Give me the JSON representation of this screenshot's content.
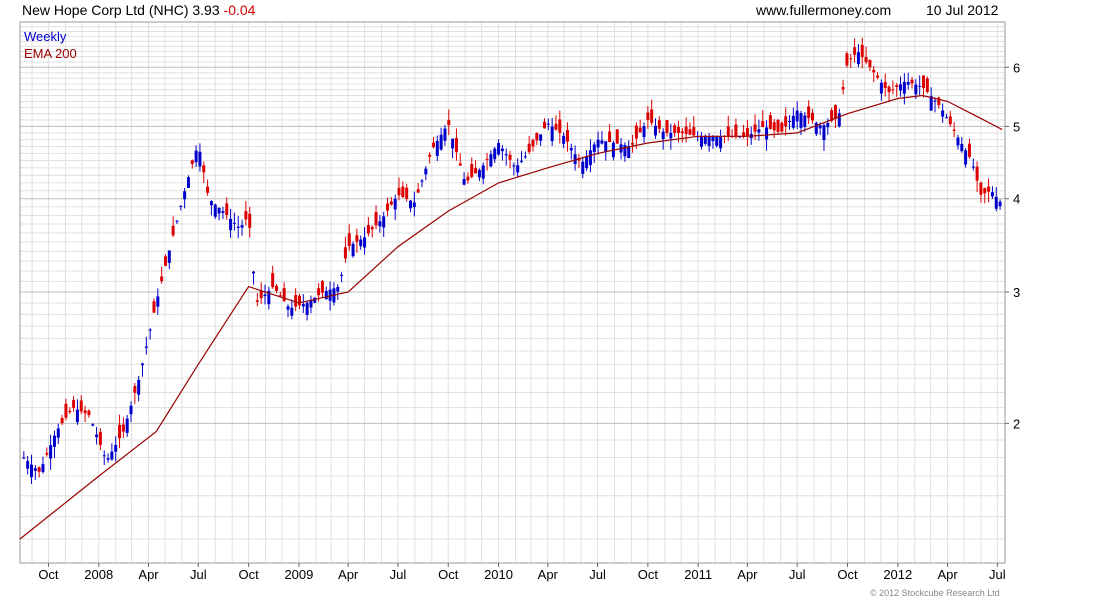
{
  "header": {
    "title": "New Hope Corp Ltd (NHC) 3.93",
    "change": "-0.04",
    "site": "www.fullermoney.com",
    "date": "10 Jul 2012"
  },
  "legend": {
    "weekly": "Weekly",
    "ema": "EMA 200"
  },
  "copyright": "© 2012 Stockcube Research Ltd",
  "colors": {
    "up": "#0000cc",
    "down": "#dd0000",
    "ema": "#990000",
    "grid": "#e0e0e0",
    "axis": "#999999"
  },
  "chart_data": {
    "type": "line",
    "frequency": "weekly",
    "y_scale": "log",
    "ylim": [
      1.3,
      6.9
    ],
    "yticks": [
      2,
      3,
      4,
      5,
      6
    ],
    "x_range": [
      "2007-08-10",
      "2012-07-15"
    ],
    "xticks": [
      {
        "date": "2007-10-01",
        "label": "Oct"
      },
      {
        "date": "2008-01-01",
        "label": "2008"
      },
      {
        "date": "2008-04-01",
        "label": "Apr"
      },
      {
        "date": "2008-07-01",
        "label": "Jul"
      },
      {
        "date": "2008-10-01",
        "label": "Oct"
      },
      {
        "date": "2009-01-01",
        "label": "2009"
      },
      {
        "date": "2009-04-01",
        "label": "Apr"
      },
      {
        "date": "2009-07-01",
        "label": "Jul"
      },
      {
        "date": "2009-10-01",
        "label": "Oct"
      },
      {
        "date": "2010-01-01",
        "label": "2010"
      },
      {
        "date": "2010-04-01",
        "label": "Apr"
      },
      {
        "date": "2010-07-01",
        "label": "Jul"
      },
      {
        "date": "2010-10-01",
        "label": "Oct"
      },
      {
        "date": "2011-01-01",
        "label": "2011"
      },
      {
        "date": "2011-04-01",
        "label": "Apr"
      },
      {
        "date": "2011-07-01",
        "label": "Jul"
      },
      {
        "date": "2011-10-01",
        "label": "Oct"
      },
      {
        "date": "2012-01-01",
        "label": "2012"
      },
      {
        "date": "2012-04-01",
        "label": "Apr"
      },
      {
        "date": "2012-07-01",
        "label": "Jul"
      }
    ],
    "close_series": {
      "name": "Weekly",
      "points": [
        [
          "2007-08-17",
          1.8
        ],
        [
          "2007-09-15",
          1.72
        ],
        [
          "2007-10-15",
          1.95
        ],
        [
          "2007-11-15",
          2.1
        ],
        [
          "2007-12-15",
          2.05
        ],
        [
          "2008-01-15",
          1.78
        ],
        [
          "2008-02-15",
          1.95
        ],
        [
          "2008-03-15",
          2.3
        ],
        [
          "2008-04-15",
          2.9
        ],
        [
          "2008-05-15",
          3.55
        ],
        [
          "2008-06-10",
          4.2
        ],
        [
          "2008-07-01",
          4.75
        ],
        [
          "2008-07-20",
          4.0
        ],
        [
          "2008-08-15",
          3.85
        ],
        [
          "2008-09-15",
          3.65
        ],
        [
          "2008-10-01",
          3.8
        ],
        [
          "2008-10-15",
          2.9
        ],
        [
          "2008-11-15",
          3.05
        ],
        [
          "2008-12-15",
          2.85
        ],
        [
          "2009-01-15",
          2.9
        ],
        [
          "2009-02-15",
          3.0
        ],
        [
          "2009-03-15",
          3.05
        ],
        [
          "2009-04-01",
          3.45
        ],
        [
          "2009-05-01",
          3.55
        ],
        [
          "2009-06-01",
          3.75
        ],
        [
          "2009-07-01",
          4.05
        ],
        [
          "2009-08-01",
          3.95
        ],
        [
          "2009-09-01",
          4.65
        ],
        [
          "2009-10-01",
          5.05
        ],
        [
          "2009-11-01",
          4.2
        ],
        [
          "2009-12-01",
          4.4
        ],
        [
          "2010-01-01",
          4.75
        ],
        [
          "2010-02-01",
          4.4
        ],
        [
          "2010-03-01",
          4.65
        ],
        [
          "2010-04-01",
          5.05
        ],
        [
          "2010-05-01",
          4.85
        ],
        [
          "2010-06-01",
          4.45
        ],
        [
          "2010-07-01",
          4.8
        ],
        [
          "2010-08-01",
          4.75
        ],
        [
          "2010-09-01",
          4.7
        ],
        [
          "2010-10-01",
          5.1
        ],
        [
          "2010-11-01",
          4.9
        ],
        [
          "2010-12-01",
          4.9
        ],
        [
          "2011-01-01",
          4.85
        ],
        [
          "2011-02-01",
          4.85
        ],
        [
          "2011-03-01",
          4.85
        ],
        [
          "2011-04-01",
          4.85
        ],
        [
          "2011-05-01",
          5.0
        ],
        [
          "2011-06-01",
          4.9
        ],
        [
          "2011-07-01",
          5.25
        ],
        [
          "2011-08-15",
          5.0
        ],
        [
          "2011-09-15",
          5.15
        ],
        [
          "2011-10-01",
          6.1
        ],
        [
          "2011-10-20",
          6.3
        ],
        [
          "2011-11-15",
          5.95
        ],
        [
          "2011-12-15",
          5.55
        ],
        [
          "2012-01-15",
          5.75
        ],
        [
          "2012-02-15",
          5.65
        ],
        [
          "2012-03-01",
          5.5
        ],
        [
          "2012-03-20",
          5.3
        ],
        [
          "2012-04-15",
          4.9
        ],
        [
          "2012-05-15",
          4.5
        ],
        [
          "2012-06-01",
          4.05
        ],
        [
          "2012-06-20",
          4.1
        ],
        [
          "2012-07-10",
          3.93
        ]
      ]
    },
    "ema_series": {
      "name": "EMA 200",
      "points": [
        [
          "2007-08-10",
          1.4
        ],
        [
          "2008-01-01",
          1.7
        ],
        [
          "2008-04-15",
          1.95
        ],
        [
          "2008-07-01",
          2.4
        ],
        [
          "2008-10-01",
          3.05
        ],
        [
          "2009-01-01",
          2.9
        ],
        [
          "2009-04-01",
          3.0
        ],
        [
          "2009-07-01",
          3.45
        ],
        [
          "2009-10-01",
          3.85
        ],
        [
          "2010-01-01",
          4.2
        ],
        [
          "2010-04-01",
          4.4
        ],
        [
          "2010-07-01",
          4.6
        ],
        [
          "2010-10-01",
          4.75
        ],
        [
          "2011-01-01",
          4.85
        ],
        [
          "2011-04-01",
          4.85
        ],
        [
          "2011-07-01",
          4.9
        ],
        [
          "2011-10-01",
          5.2
        ],
        [
          "2012-01-01",
          5.45
        ],
        [
          "2012-02-15",
          5.5
        ],
        [
          "2012-04-01",
          5.4
        ],
        [
          "2012-05-15",
          5.2
        ],
        [
          "2012-07-10",
          4.95
        ]
      ]
    }
  }
}
